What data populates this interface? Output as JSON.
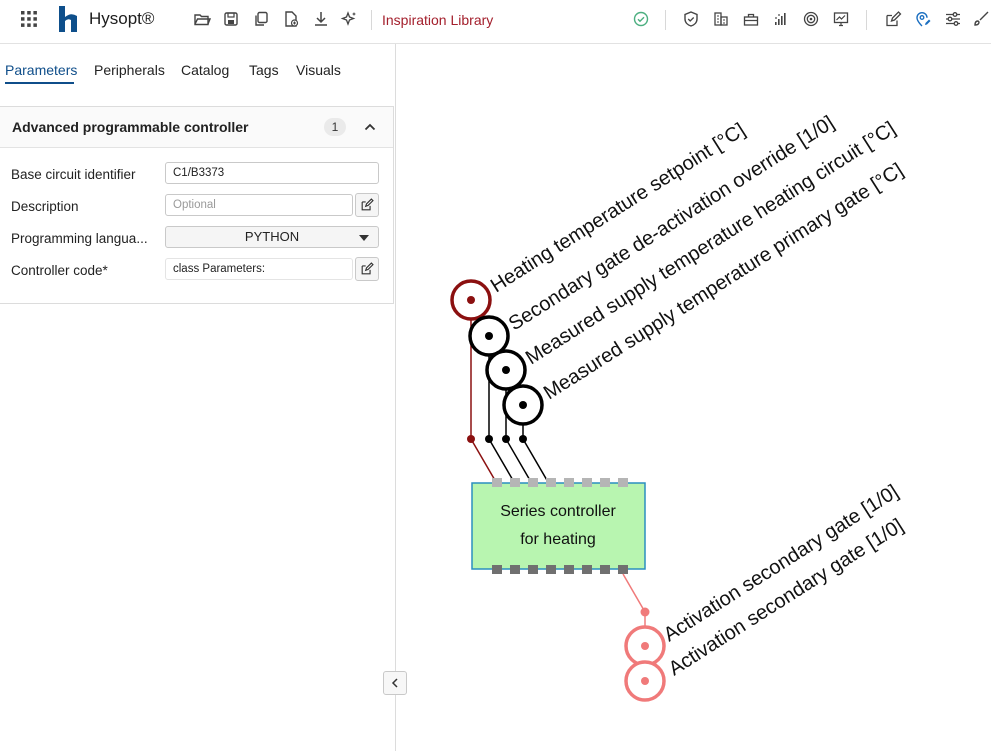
{
  "app": {
    "brand_name": "Hysopt®",
    "library_link": "Inspiration Library"
  },
  "tabs": [
    {
      "label": "Parameters",
      "active": true
    },
    {
      "label": "Peripherals",
      "active": false
    },
    {
      "label": "Catalog",
      "active": false
    },
    {
      "label": "Tags",
      "active": false
    },
    {
      "label": "Visuals",
      "active": false
    }
  ],
  "card": {
    "title": "Advanced programmable controller",
    "count": "1",
    "fields": {
      "base_circuit_identifier": {
        "label": "Base circuit identifier",
        "value": "C1/B3373"
      },
      "description": {
        "label": "Description",
        "placeholder": "Optional"
      },
      "programming_language": {
        "label": "Programming langua...",
        "value": "PYTHON"
      },
      "controller_code": {
        "label": "Controller code*",
        "value": "class Parameters:"
      }
    }
  },
  "diagram": {
    "controller_label_line1": "Series controller",
    "controller_label_line2": "for heating",
    "inputs": [
      {
        "label": "Heating temperature setpoint [°C]",
        "color": "#8b1010"
      },
      {
        "label": "Secondary gate de-activation override [1/0]",
        "color": "#000000"
      },
      {
        "label": "Measured supply temperature heating circuit [°C]",
        "color": "#000000"
      },
      {
        "label": "Measured supply temperature primary gate [°C]",
        "color": "#000000"
      }
    ],
    "outputs": [
      {
        "label": "Activation secondary gate [1/0]",
        "color": "#f07a7a"
      },
      {
        "label": "Activation secondary gate [1/0]",
        "color": "#f07a7a"
      }
    ],
    "controller_fill": "#b8f5b0",
    "controller_border": "#2a8fbf"
  },
  "icons": {
    "toolbar_left": [
      "apps-grid-icon",
      "open-folder-icon",
      "save-icon",
      "copy-icon",
      "new-file-icon",
      "download-icon",
      "sparkle-icon"
    ],
    "toolbar_right": [
      "check-circle-icon",
      "shield-icon",
      "building-icon",
      "toolbox-icon",
      "chart-dots-icon",
      "target-icon",
      "monitor-chart-icon",
      "edit-icon",
      "location-edit-icon",
      "sliders-icon",
      "brush-icon"
    ]
  }
}
